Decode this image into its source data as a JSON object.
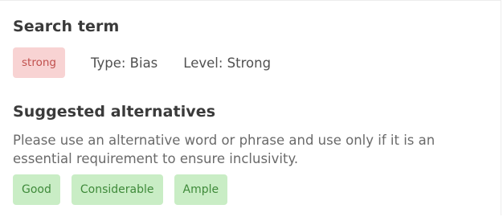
{
  "search_term": {
    "heading": "Search term",
    "term": "strong",
    "type_text": "Type: Bias",
    "level_text": "Level: Strong",
    "chip_color": "#f8d3d3",
    "chip_text_color": "#c0504d"
  },
  "alternatives": {
    "heading": "Suggested alternatives",
    "description": "Please use an alternative word or phrase and use only if it is an essential requirement to ensure inclusivity.",
    "items": [
      {
        "label": "Good"
      },
      {
        "label": "Considerable"
      },
      {
        "label": "Ample"
      }
    ],
    "chip_color": "#c9edc5",
    "chip_text_color": "#3f8a3a"
  }
}
